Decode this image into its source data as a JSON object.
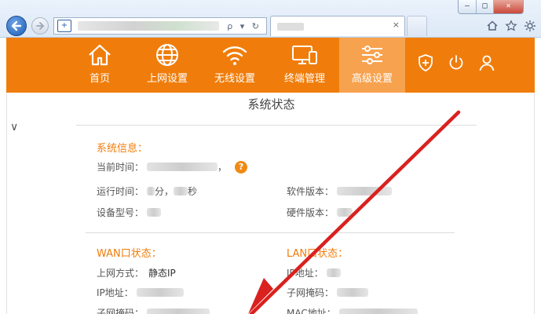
{
  "browser": {
    "window_controls": [
      "—",
      "□",
      "✕"
    ],
    "address_tools": "ρ ▾ ↻",
    "toolbar_icons": [
      "home-icon",
      "star-icon",
      "gear-icon"
    ]
  },
  "colors": {
    "accent": "#f07d0b",
    "accent_active": "#f7a24e",
    "arrow": "#d9211f"
  },
  "nav": {
    "items": [
      {
        "label": "首页",
        "icon": "home-icon"
      },
      {
        "label": "上网设置",
        "icon": "globe-icon"
      },
      {
        "label": "无线设置",
        "icon": "wifi-icon"
      },
      {
        "label": "终端管理",
        "icon": "devices-icon"
      },
      {
        "label": "高级设置",
        "icon": "sliders-icon"
      }
    ],
    "utility_icons": [
      "shield-icon",
      "power-icon",
      "user-icon"
    ]
  },
  "main": {
    "title": "系统状态",
    "system_info": {
      "heading": "系统信息：",
      "current_time_label": "当前时间：",
      "current_time_suffix": "，",
      "uptime_label": "运行时间：",
      "uptime_min": "分，",
      "uptime_sec": "秒",
      "software_version_label": "软件版本：",
      "device_model_label": "设备型号：",
      "hardware_version_label": "硬件版本："
    },
    "wan": {
      "heading": "WAN口状态：",
      "mode_label": "上网方式：",
      "mode_value": "静态IP",
      "ip_label": "IP地址：",
      "mask_label": "子网掩码："
    },
    "lan": {
      "heading": "LAN口状态：",
      "ip_label": "IP地址：",
      "mask_label": "子网掩码：",
      "mac_label": "MAC地址："
    }
  }
}
